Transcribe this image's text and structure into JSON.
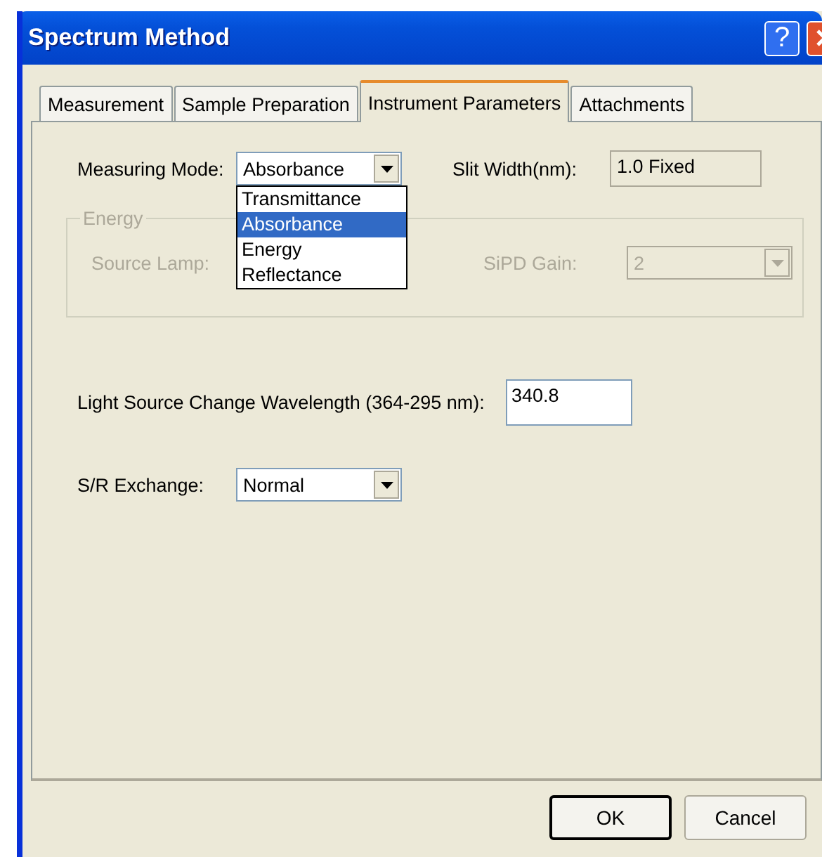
{
  "window": {
    "title": "Spectrum Method",
    "help_button": "?"
  },
  "tabs": [
    {
      "label": "Measurement",
      "selected": false
    },
    {
      "label": "Sample Preparation",
      "selected": false
    },
    {
      "label": "Instrument Parameters",
      "selected": true
    },
    {
      "label": "Attachments",
      "selected": false
    }
  ],
  "measuring_mode": {
    "label": "Measuring Mode:",
    "value": "Absorbance",
    "expanded": true,
    "options": [
      {
        "label": "Transmittance",
        "selected": false
      },
      {
        "label": "Absorbance",
        "selected": true
      },
      {
        "label": "Energy",
        "selected": false
      },
      {
        "label": "Reflectance",
        "selected": false
      }
    ]
  },
  "slit_width": {
    "label": "Slit Width(nm):",
    "value": "1.0 Fixed"
  },
  "energy": {
    "title": "Energy",
    "disabled": true,
    "source_lamp": {
      "label": "Source Lamp:"
    },
    "sipd_gain": {
      "label": "SiPD Gain:",
      "value": "2"
    }
  },
  "light_source": {
    "label": "Light Source Change Wavelength (364-295 nm):",
    "value": "340.8"
  },
  "sr_exchange": {
    "label": "S/R Exchange:",
    "value": "Normal"
  },
  "buttons": [
    {
      "label": "OK",
      "default": true
    },
    {
      "label": "Cancel",
      "default": false
    }
  ]
}
